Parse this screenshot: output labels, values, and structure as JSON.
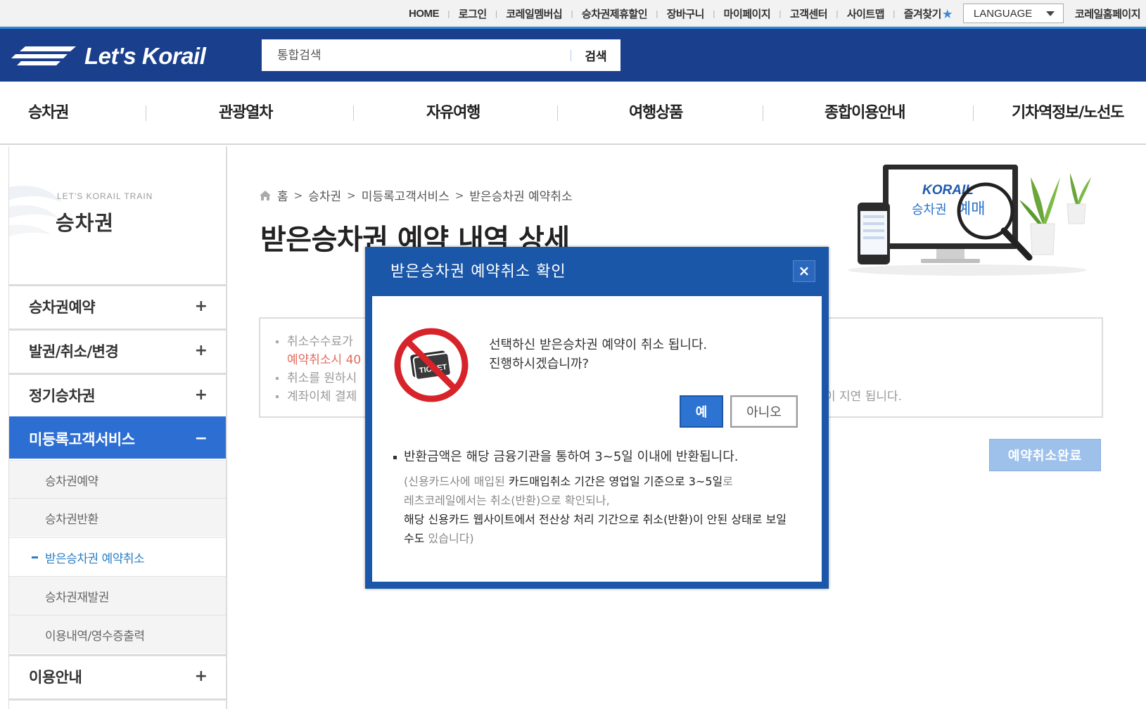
{
  "util_bar": {
    "links": [
      "HOME",
      "로그인",
      "코레일멤버십",
      "승차권제휴할인",
      "장바구니",
      "마이페이지",
      "고객센터",
      "사이트맵"
    ],
    "favorites_label": "즐겨찾기",
    "language_label": "LANGUAGE",
    "korail_home_label": "코레일홈페이지"
  },
  "header": {
    "logo_text": "Let's Korail",
    "search_placeholder": "통합검색",
    "search_button": "검색"
  },
  "gnb": {
    "items": [
      "승차권",
      "관광열차",
      "자유여행",
      "여행상품",
      "종합이용안내",
      "기차역정보/노선도"
    ]
  },
  "lnb": {
    "sub_title": "LET'S KORAIL TRAIN",
    "title": "승차권",
    "menus": [
      {
        "label": "승차권예약",
        "toggle": "+"
      },
      {
        "label": "발권/취소/변경",
        "toggle": "+"
      },
      {
        "label": "정기승차권",
        "toggle": "+"
      },
      {
        "label": "미등록고객서비스",
        "toggle": "−"
      },
      {
        "label": "이용안내",
        "toggle": "+"
      }
    ],
    "sub_items": [
      "승차권예약",
      "승차권반환",
      "받은승차권 예약취소",
      "승차권재발권",
      "이용내역/영수증출력"
    ]
  },
  "breadcrumb": [
    "홈",
    "승차권",
    "미등록고객서비스",
    "받은승차권 예약취소"
  ],
  "page_title": "받은승차권 예약 내역 상세",
  "banner": {
    "brand": "KORAIL",
    "caption_a": "승차권",
    "caption_b": "예매"
  },
  "notice": {
    "lines": [
      "취소수수료가",
      "예약취소시 40",
      "취소를 원하시",
      "계좌이체 결제"
    ],
    "tail": "이 지연 됩니다."
  },
  "complete_button": "예약취소완료",
  "modal": {
    "title": "받은승차권 예약취소 확인",
    "close": "×",
    "icon_text": "TICKET",
    "message_line1": "선택하신 받은승차권 예약이 취소 됩니다.",
    "message_line2": "진행하시겠습니까?",
    "yes": "예",
    "no": "아니오",
    "refund_note": "반환금액은 해당 금융기관을 통하여 3~5일 이내에 반환됩니다.",
    "detail": {
      "p1": "(신용카드사에 매입된 ",
      "s1": "카드매입취소 기간은 영업일 기준으로 3~5일",
      "p2": "로",
      "p3": "레츠코레일에서는 취소(반환)으로 확인되나,",
      "s2": "해당 신용카드 웹사이트에서 전산상 처리 기간으로 취소(반환)이 안된 상태로 보일 수도",
      "p4": " 있습니다)"
    }
  },
  "colors": {
    "header_bg": "#1a3f8c",
    "active_menu": "#2d6ed3",
    "modal_bg": "#1b57a8",
    "yes_button": "#2d73d2",
    "complete_button": "#9ec1ec"
  }
}
